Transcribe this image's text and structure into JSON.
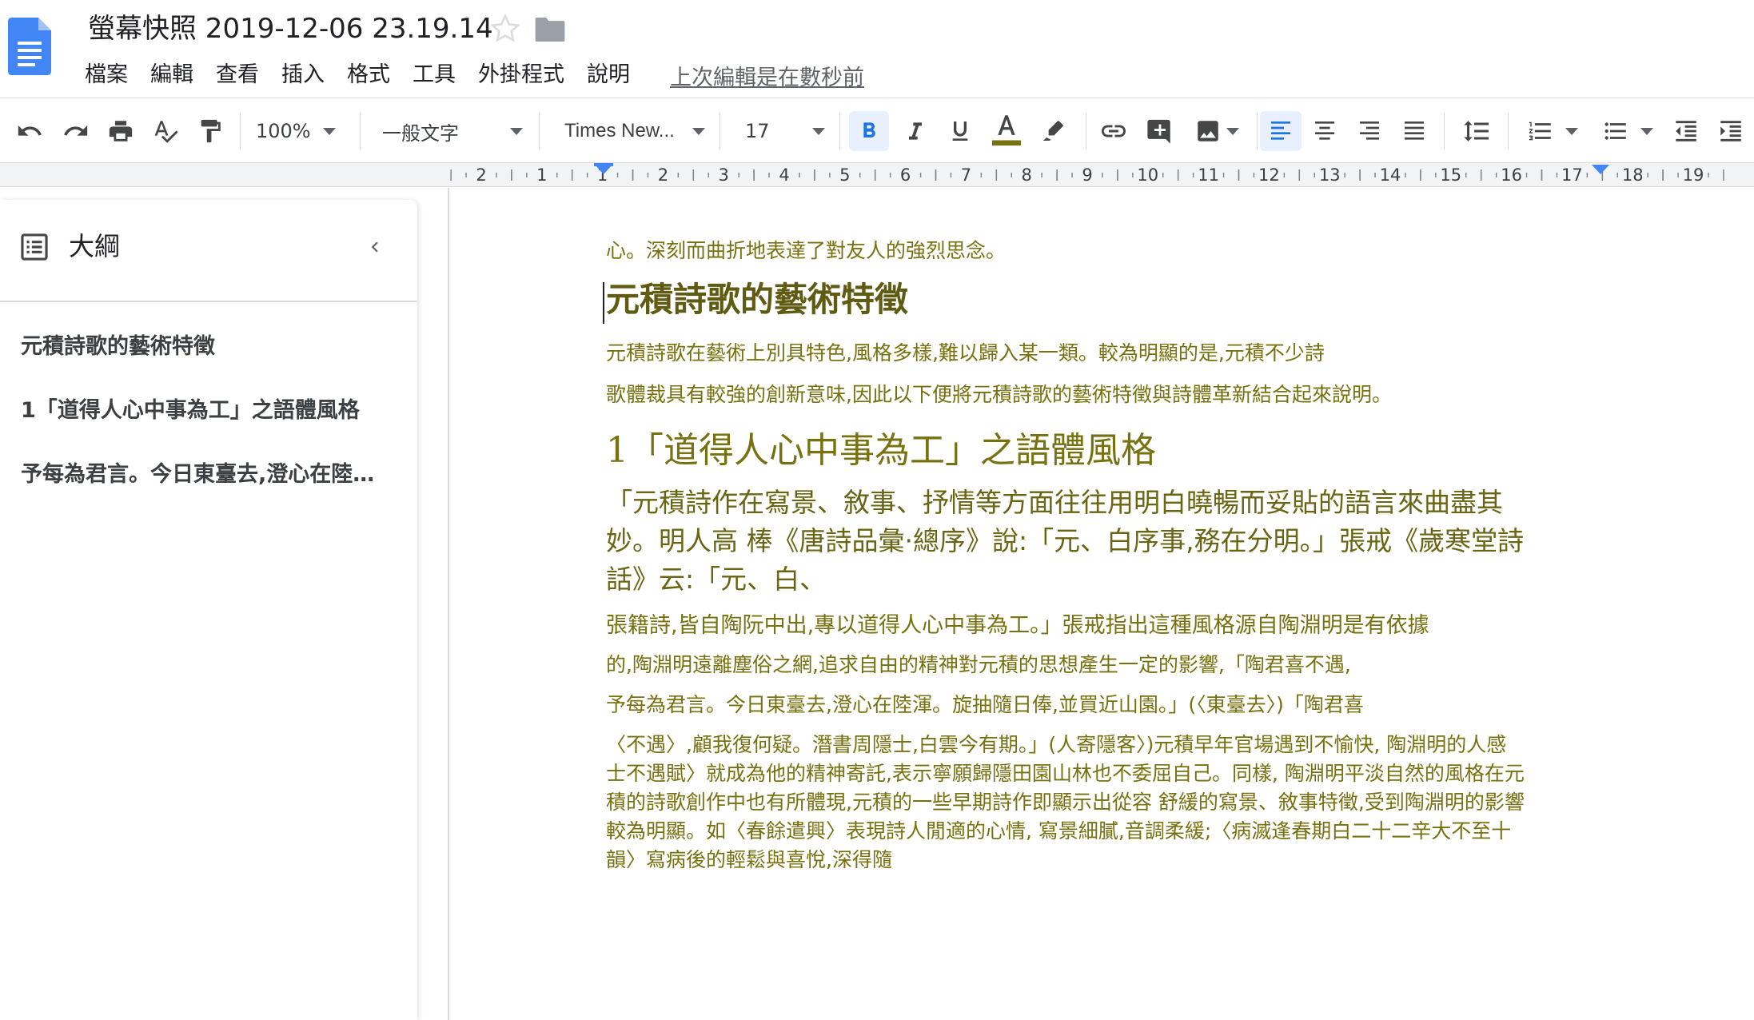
{
  "document": {
    "title": "螢幕快照 2019-12-06 23.19.14"
  },
  "menu": {
    "items": [
      "檔案",
      "編輯",
      "查看",
      "插入",
      "格式",
      "工具",
      "外掛程式",
      "說明"
    ],
    "last_edit": "上次編輯是在數秒前"
  },
  "toolbar": {
    "zoom": "100%",
    "style": "一般文字",
    "font": "Times New...",
    "font_size": "17",
    "icons": [
      "undo-icon",
      "redo-icon",
      "print-icon",
      "spellcheck-icon",
      "paint-format-icon",
      "bold-icon",
      "italic-icon",
      "underline-icon",
      "text-color-icon",
      "highlight-icon",
      "link-icon",
      "comment-icon",
      "image-icon",
      "align-left-icon",
      "align-center-icon",
      "align-right-icon",
      "justify-icon",
      "line-spacing-icon",
      "numbered-list-icon",
      "bulleted-list-icon",
      "decrease-indent-icon",
      "increase-indent-icon"
    ],
    "text_color_bar": "#77710f",
    "active_color": "#1a73e8"
  },
  "ruler": {
    "labels": [
      "2",
      "1",
      "1",
      "2",
      "3",
      "4",
      "5",
      "6",
      "7",
      "8",
      "9",
      "10",
      "11",
      "12",
      "13",
      "14",
      "15",
      "16",
      "17",
      "18",
      "19"
    ]
  },
  "outline": {
    "title": "大綱",
    "items": [
      "元積詩歌的藝術特徵",
      "1「道得人心中事為工」之語體風格",
      "予每為君言。今日東臺去,澄心在陸…"
    ]
  },
  "page": {
    "lines": [
      "心。深刻而曲折地表達了對友人的強烈思念。",
      "元積詩歌的藝術特徵",
      "元積詩歌在藝術上別具特色,風格多樣,難以歸入某一類。較為明顯的是,元積不少詩",
      "歌體裁具有較強的創新意味,因此以下便將元積詩歌的藝術特徵與詩體革新結合起來說明。",
      "1「道得人心中事為工」之語體風格",
      "「元積詩作在寫景、敘事、抒情等方面往往用明白曉暢而妥貼的語言來曲盡其",
      "妙。明人高 棒《唐詩品彙·總序》說:「元、白序事,務在分明。」張戒《歲寒堂詩",
      "話》云:「元、白、",
      "張籍詩,皆自陶阮中出,專以道得人心中事為工。」張戒指出這種風格源自陶淵明是有依據",
      "的,陶淵明遠離塵俗之網,追求自由的精神對元積的思想產生一定的影響,「陶君喜不遇,",
      "予每為君言。今日東臺去,澄心在陸渾。旋抽隨日俸,並買近山園。」(〈東臺去〉)「陶君喜",
      "〈不遇〉,顧我復何疑。潛書周隱士,白雲今有期。」(人寄隱客〉)元積早年官場遇到不愉快, 陶淵明的人感",
      "士不遇賦〉就成為他的精神寄託,表示寧願歸隱田園山林也不委屈自己。同樣, 陶淵明平淡自然的風格在元",
      "積的詩歌創作中也有所體現,元積的一些早期詩作即顯示出從容 舒緩的寫景、敘事特徵,受到陶淵明的影響",
      "較為明顯。如〈春餘遣興〉表現詩人閒適的心情, 寫景細膩,音調柔緩;〈病滅逢春期白二十二辛大不至十",
      "韻〉寫病後的輕鬆與喜悅,深得隨"
    ]
  }
}
